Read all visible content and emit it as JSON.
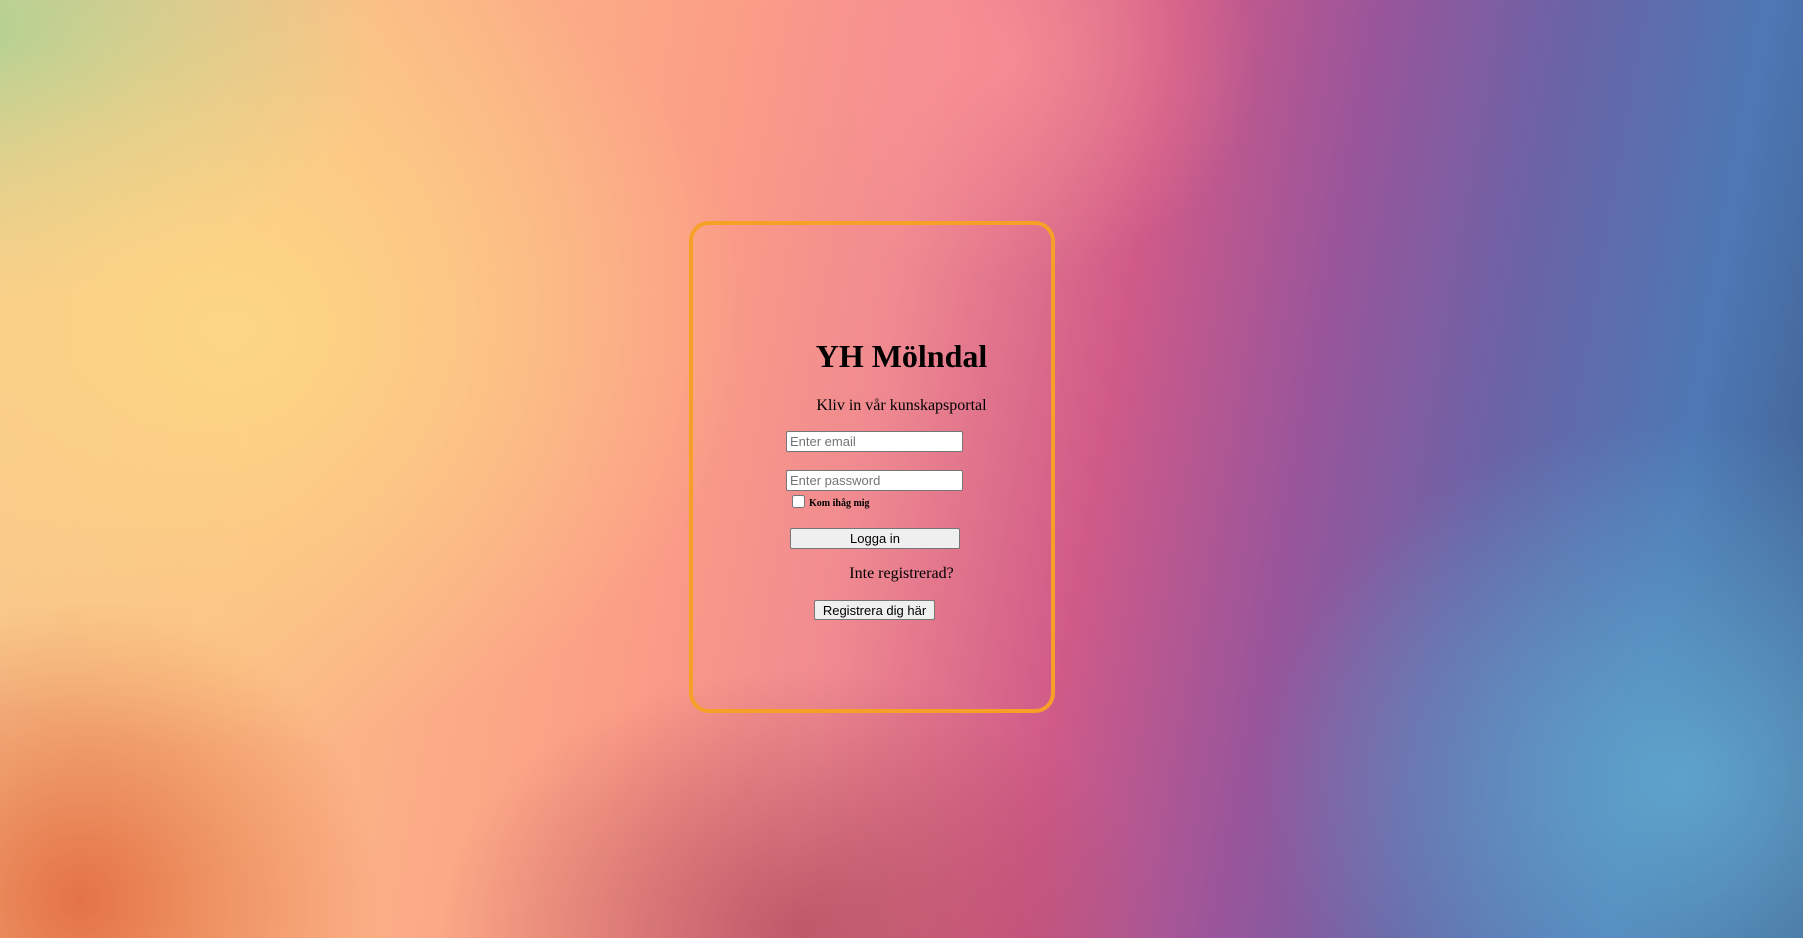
{
  "page": {
    "background_colors": [
      "#a8d096",
      "#fcd884",
      "#fb9d86",
      "#cf5a88",
      "#6a63a6",
      "#60a8ce"
    ],
    "card_border_color": "#f7a028"
  },
  "login": {
    "title": "YH Mölndal",
    "subtitle": "Kliv in vår kunskapsportal",
    "email_placeholder": "Enter email",
    "email_value": "",
    "password_placeholder": "Enter password",
    "password_value": "",
    "remember_label": "Kom ihåg mig",
    "remember_checked": false,
    "login_button_label": "Logga in",
    "not_registered_text": "Inte registrerad?",
    "register_button_label": "Registrera dig här"
  }
}
